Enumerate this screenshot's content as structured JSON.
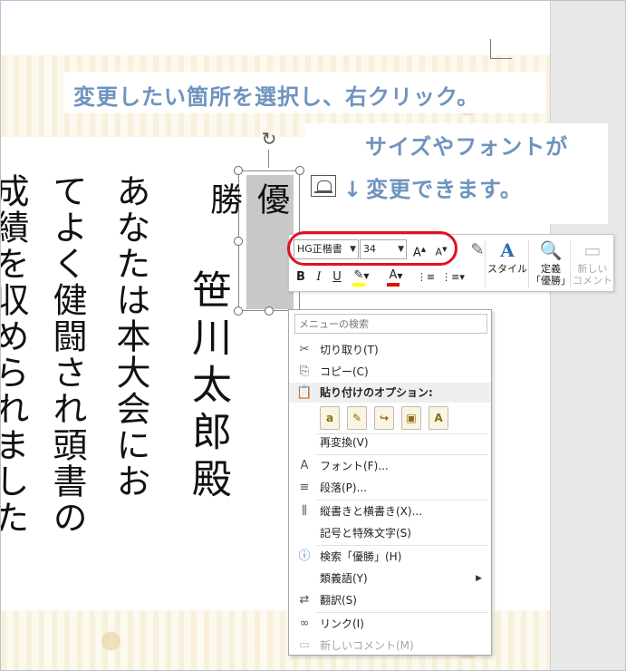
{
  "instructions": {
    "line1": "変更したい箇所を選択し、右クリック。",
    "line2": "サイズやフォントが",
    "line3_arrow": "↓",
    "line3": "変更できます。"
  },
  "certificate": {
    "selected_text": "優勝",
    "recipient": "笹川太郎殿",
    "body_col1": "あなたは本大会にお",
    "body_col2": "てよく健闘され頭書の",
    "body_col3": "成績を収められました"
  },
  "mini_toolbar": {
    "font_name": "HG正楷書",
    "font_size": "34",
    "grow_font": "A",
    "shrink_font": "A",
    "bold": "B",
    "italic": "I",
    "underline": "U",
    "font_color": "A",
    "style_label": "スタイル",
    "define_label_1": "定義",
    "define_label_2": "「優勝」",
    "new_comment_label_1": "新しい",
    "new_comment_label_2": "コメント"
  },
  "context_menu": {
    "search_placeholder": "メニューの検索",
    "cut": "切り取り(T)",
    "copy": "コピー(C)",
    "paste_options": "貼り付けのオプション:",
    "reconvert": "再変換(V)",
    "font": "フォント(F)...",
    "paragraph": "段落(P)...",
    "vertical_horizontal": "縦書きと横書き(X)...",
    "symbols": "記号と特殊文字(S)",
    "search_item": "検索「優勝」(H)",
    "synonyms": "類義語(Y)",
    "translate": "翻訳(S)",
    "link": "リンク(I)",
    "new_comment": "新しいコメント(M)"
  },
  "colors": {
    "callout_text": "#6f93bf",
    "highlight_ellipse": "#e0121e",
    "highlight_yellow": "#ffff00",
    "font_color_red": "#d11111"
  },
  "icons": {
    "rotate": "↻",
    "cut": "✂",
    "copy": "⎘",
    "paste": "📋",
    "font": "A",
    "paragraph": "≡",
    "vertical": "⫼",
    "search": "ⓘ",
    "translate": "⇄",
    "link": "∞",
    "comment": "▭"
  }
}
